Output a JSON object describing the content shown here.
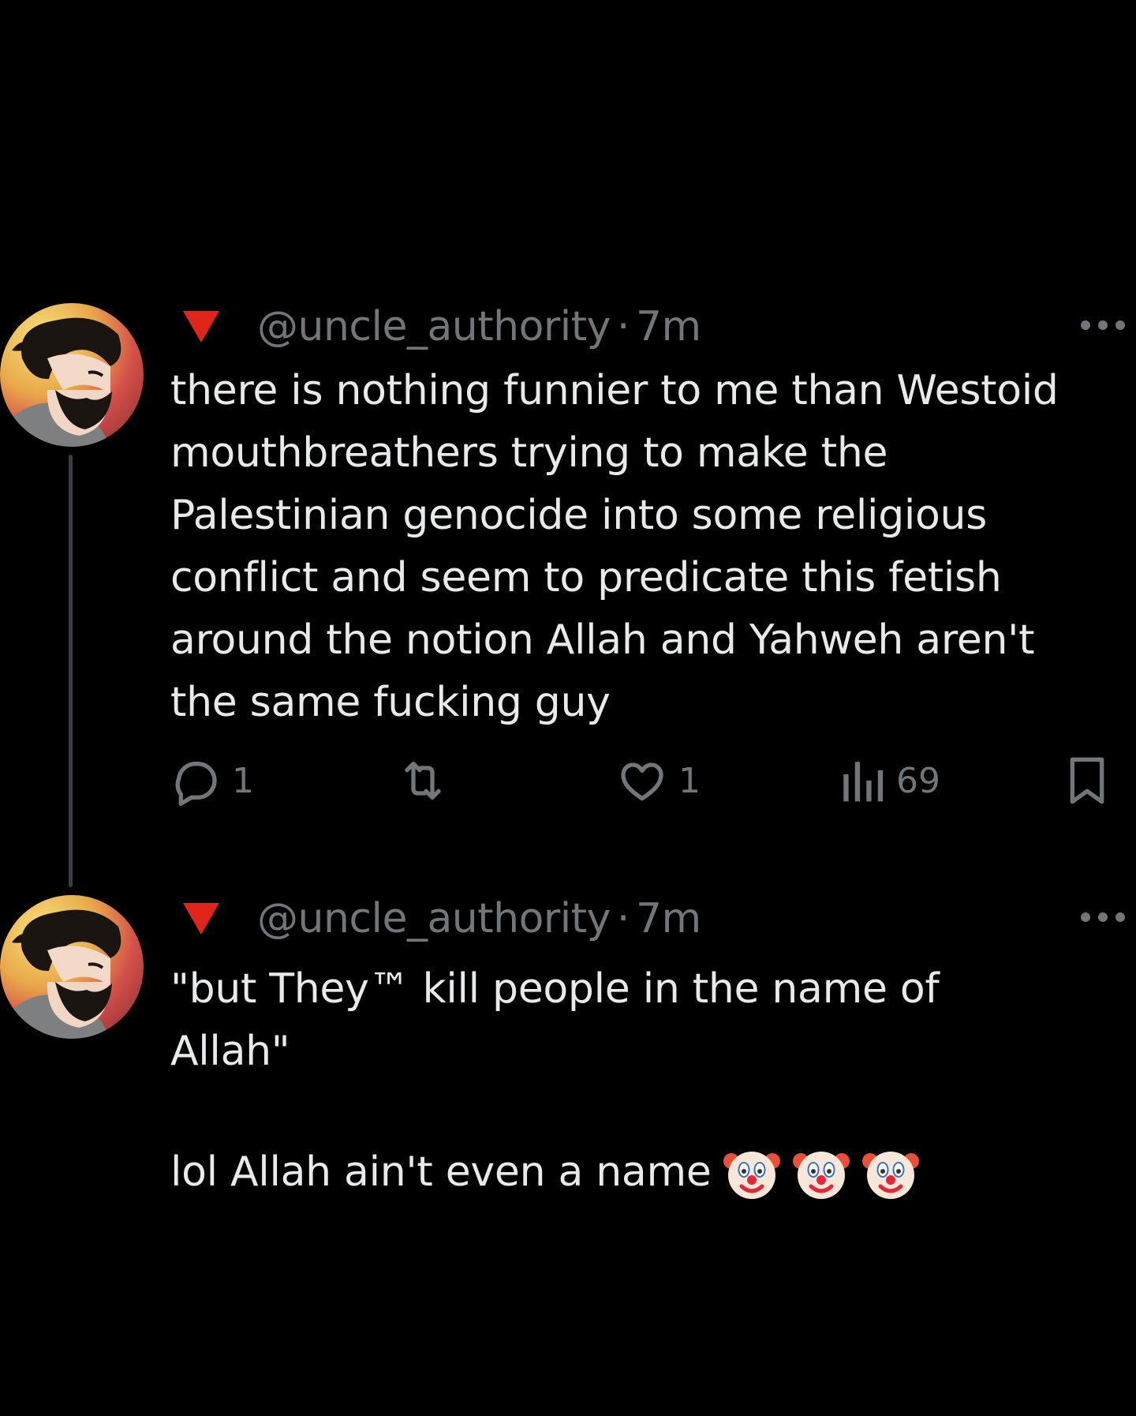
{
  "thread": [
    {
      "handle": "@uncle_authority",
      "separator": "·",
      "time": "7m",
      "text": "there is nothing funnier to me than Westoid\nmouthbreathers trying to make the\nPalestinian genocide into some religious\nconflict and seem to predicate this fetish\naround the  notion Allah and Yahweh aren't\nthe same fucking guy",
      "actions": {
        "replies": "1",
        "reposts": "",
        "likes": "1",
        "views": "69"
      }
    },
    {
      "handle": "@uncle_authority",
      "separator": "·",
      "time": "7m",
      "text": "\"but They™ kill people in the name of\nAllah\"",
      "last_line": "lol Allah ain't even a name",
      "emoji": [
        "clown-face",
        "clown-face",
        "clown-face"
      ]
    }
  ],
  "icons": {
    "flag": "red-triangle-down-icon",
    "more": "more-dots-icon",
    "reply": "reply-icon",
    "repost": "repost-icon",
    "like": "heart-icon",
    "views": "views-icon",
    "bookmark": "bookmark-icon"
  },
  "colors": {
    "background": "#000000",
    "text": "#e7e9ea",
    "secondary": "#71767b",
    "thread_line": "#3a3d41",
    "flag_red": "#e0261b"
  }
}
